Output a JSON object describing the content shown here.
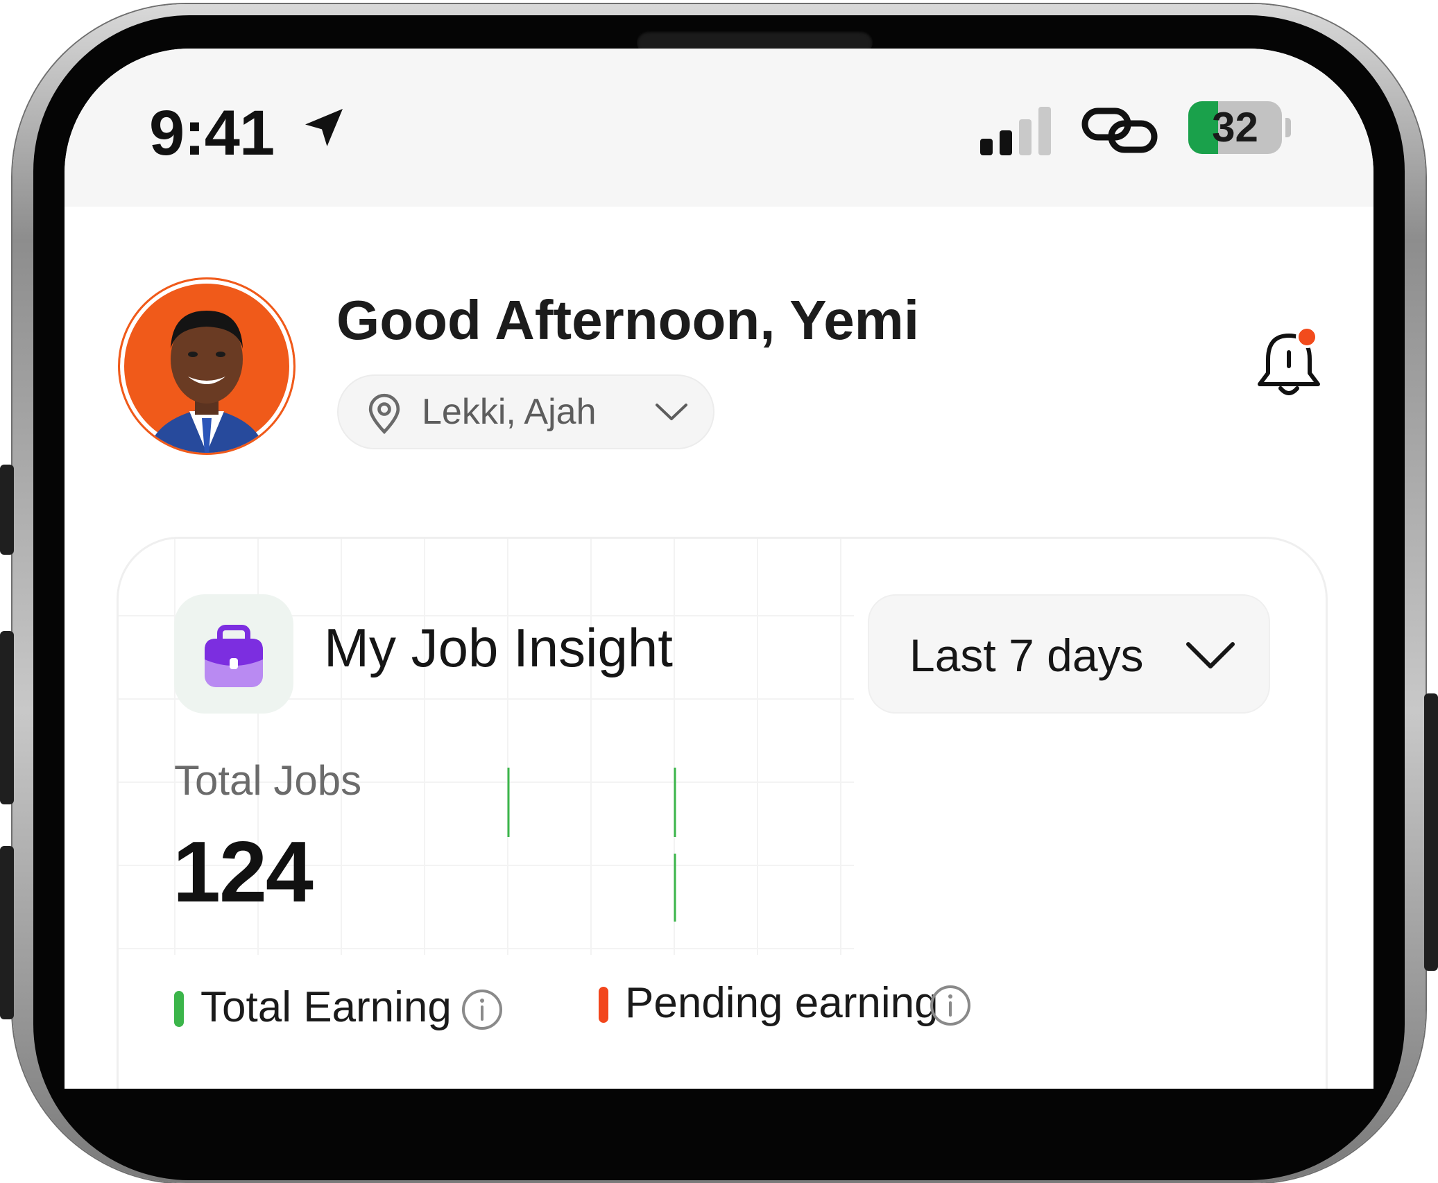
{
  "status_bar": {
    "time": "9:41",
    "battery": "32",
    "battery_level": 0.32,
    "icons": [
      "location-arrow-icon",
      "cellular-signal-icon",
      "link-icon",
      "battery-icon"
    ]
  },
  "header": {
    "greeting": "Good Afternoon, Yemi",
    "location": "Lekki, Ajah",
    "location_icon": "map-pin-icon",
    "location_chevron": "chevron-down-icon",
    "notification_icon": "bell-icon",
    "notification_dot_color": "#f24b1c",
    "avatar_bg_color": "#f05a1a"
  },
  "insight_card": {
    "title": "My Job Insight",
    "icon": "briefcase-icon",
    "range": "Last 7 days",
    "total_jobs_label": "Total Jobs",
    "total_jobs_value": "124",
    "legend": [
      {
        "label": "Total Earning",
        "color": "#3bb54a"
      },
      {
        "label": "Pending earning",
        "color": "#f2461c"
      }
    ]
  }
}
